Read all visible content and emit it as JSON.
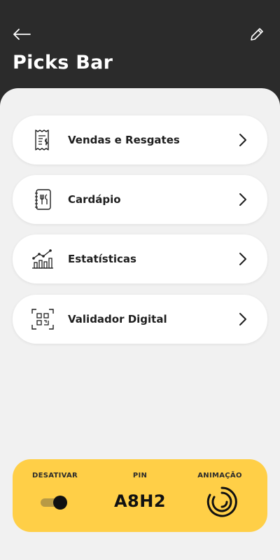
{
  "header": {
    "title": "Picks Bar",
    "back_icon": "arrow-left-icon",
    "edit_icon": "pencil-icon"
  },
  "menu": {
    "items": [
      {
        "label": "Vendas e Resgates",
        "icon": "receipt-dollar-icon"
      },
      {
        "label": "Cardápio",
        "icon": "menu-book-cutlery-icon"
      },
      {
        "label": "Estatísticas",
        "icon": "bar-chart-trend-icon"
      },
      {
        "label": "Validador Digital",
        "icon": "qr-code-scan-icon"
      }
    ],
    "chevron_icon": "chevron-right-icon"
  },
  "bottom_card": {
    "deactivate_label": "DESATIVAR",
    "pin_label": "PIN",
    "pin_value": "A8H2",
    "animation_label": "ANIMAÇÃO",
    "toggle_on": true
  },
  "colors": {
    "header_bg": "#2b2b2b",
    "content_bg": "#f1f1f1",
    "card_bg": "#ffffff",
    "accent": "#ffcf47"
  }
}
